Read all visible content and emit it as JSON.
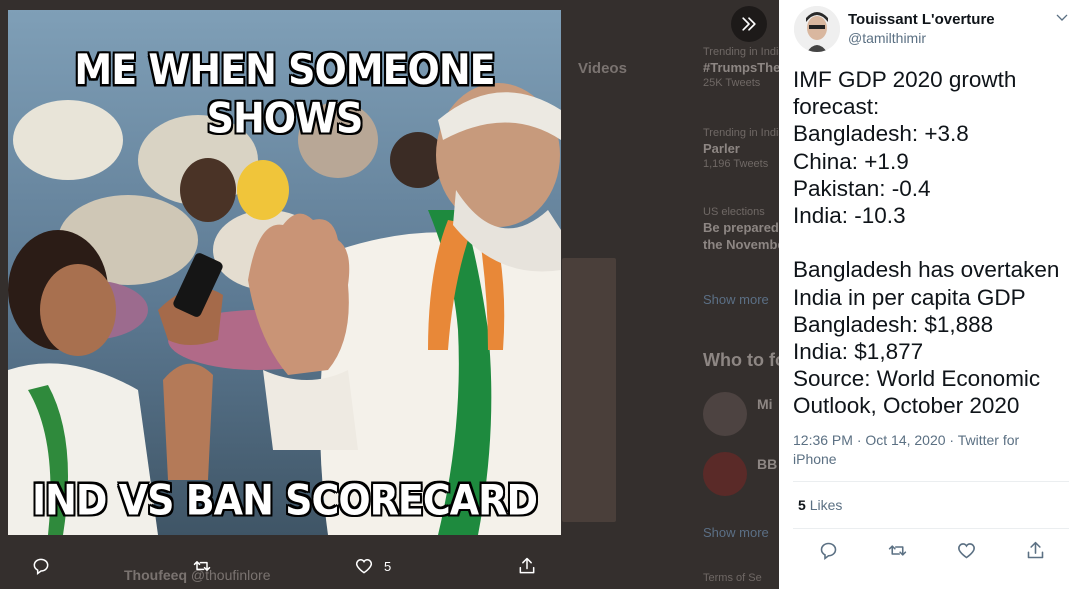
{
  "background": {
    "tabs_label": "Videos",
    "trends": [
      {
        "category": "Trending in India",
        "name": "#TrumpsTheOne",
        "count": "25K Tweets"
      },
      {
        "category": "Trending in India",
        "name": "Parler",
        "count": "1,196 Tweets"
      }
    ],
    "trend3": {
      "category": "US elections",
      "name": "Be prepared to vote in",
      "name2": "the November"
    },
    "show_more": "Show more",
    "who_to_follow": "Who to follow",
    "accounts": [
      "Mi",
      "BB"
    ],
    "show_more2": "Show more",
    "user_name": "Thoufeeq",
    "user_handle": "@thoufinlore",
    "terms": "Terms of Se"
  },
  "meme": {
    "top_caption": "ME WHEN SOMEONE SHOWS",
    "bottom_caption": "IND VS BAN SCORECARD"
  },
  "image_actions": {
    "like_count": "5"
  },
  "tweet": {
    "display_name": "Touissant L'overture",
    "handle": "@tamilthimir",
    "lines": [
      "IMF GDP 2020 growth",
      "forecast:",
      "Bangladesh: +3.8",
      "China: +1.9",
      "Pakistan: -0.4",
      "India: -10.3",
      "",
      "Bangladesh has overtaken",
      "India in per capita GDP",
      "Bangladesh: $1,888",
      "India: $1,877",
      "Source: World Economic",
      "Outlook, October 2020"
    ],
    "timestamp": "12:36 PM · Oct 14, 2020 · Twitter for iPhone",
    "likes_count": "5",
    "likes_label": "Likes"
  },
  "icons": {
    "reply": "reply-icon",
    "retweet": "retweet-icon",
    "like": "heart-icon",
    "share": "share-icon",
    "next": "chevron-double-right-icon",
    "caret": "chevron-down-icon"
  },
  "colors": {
    "overlay": "#3b3533",
    "panel": "#ffffff",
    "secondary_text": "#5b7083",
    "icon_panel": "#5b7083"
  }
}
